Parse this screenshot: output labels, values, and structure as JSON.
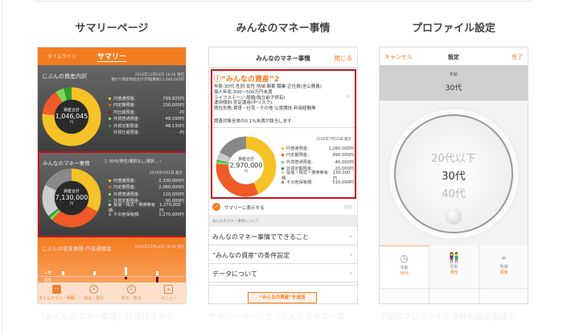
{
  "headings": [
    "サマリーページ",
    "みんなのマネー事情",
    "プロファイル設定"
  ],
  "captions": [
    "「みんなのマネー事情」は当行スマホ",
    "サマリーページで「みんなのマネー事",
    "下記はプロファイル条件の設定画面で"
  ],
  "colors": {
    "accent": "#f47c20",
    "highlight": "#c4141b",
    "yen_savings": "#f5c227",
    "yen_time": "#f05a28",
    "yen_other": "#8b1a1a",
    "fx_savings": "#7ed957",
    "fx_time": "#2e9e2e",
    "fx_other": "#1d5e1d",
    "stocks": "#cccccc",
    "other": "#888888"
  },
  "summary": {
    "tabs": [
      "タイムライン",
      "サマリー"
    ],
    "assets": {
      "title": "じぶんの資産内訳",
      "date": "2016年11月14日 18:16 現在",
      "sub": "預かり資産残高合計(円換算額):1,046,045円",
      "total_label": "資産合計",
      "total": "1,046,045",
      "unit": "円",
      "items": [
        {
          "label": "円普通預金:",
          "value": "799,825円",
          "amount": 799825,
          "color": "#f5c227"
        },
        {
          "label": "円定期預金:",
          "value": "150,000円",
          "amount": 150000,
          "color": "#f05a28"
        },
        {
          "label": "円仕組預金:",
          "value": "-円",
          "amount": 0,
          "color": "#8b1a1a"
        },
        {
          "label": "外貨普通預金:",
          "value": "48,090円",
          "amount": 48090,
          "color": "#7ed957"
        },
        {
          "label": "外貨定期預金:",
          "value": "48,130円",
          "amount": 48130,
          "color": "#2e9e2e"
        },
        {
          "label": "外貨仕組預金:",
          "value": "-円",
          "amount": 0,
          "color": "#1d5e1d"
        }
      ]
    },
    "money": {
      "title": "みんなのマネー事情",
      "filter": "30代/男性/選択なし/選択…",
      "date": "2016年6月1日 集計",
      "total_label": "資産合計",
      "total": "7,130,000",
      "unit": "円",
      "items": [
        {
          "label": "円普通預金:",
          "value": "2,330,000円",
          "amount": 2330000,
          "color": "#f5c227"
        },
        {
          "label": "円定期預金:",
          "value": "2,060,000円",
          "amount": 2060000,
          "color": "#f05a28"
        },
        {
          "label": "外貨普通預金:",
          "value": "110,000円",
          "amount": 110000,
          "color": "#7ed957"
        },
        {
          "label": "外貨定期預金:",
          "value": "90,000円",
          "amount": 90000,
          "color": "#2e9e2e"
        },
        {
          "label": "投信・株式・債券等有額:",
          "value": "1,270,000円",
          "amount": 1270000,
          "color": "#cccccc"
        },
        {
          "label": "その他保有額:",
          "value": "1,270,000円",
          "amount": 1270000,
          "color": "#888888"
        }
      ]
    },
    "flow": {
      "title": "じぶんの収支推移:円普通預金",
      "date": "2016年11月14日 18:16 現在",
      "in_label": "入金",
      "out_label": "出金"
    },
    "tabbar": [
      "タイムライン・明細",
      "振込・取引",
      "知る・学ぶ",
      "メニュー"
    ]
  },
  "money_page": {
    "title": "みんなのマネー事情",
    "close": "閉じる",
    "card": {
      "name": "“みんなの資産”2",
      "lines": [
        "年齢:30代 性別:女性 地域:関東 職業:正社員(含公務員)",
        "個人年収:300〜500万円未満",
        "ライフステージ:既婚(独立前子供有)",
        "運用傾向:安定運用(中リスク)",
        "居住形態:賃貸・社宅・その他 公営競技:利用経験無"
      ],
      "note": "調査対象全体の0.1%未満が該当します",
      "date": "2016年7月15日 集計",
      "total_label": "資産合計",
      "total": "2,970,000",
      "unit": "円",
      "items": [
        {
          "label": "円普通預金:",
          "value": "1,280,000円",
          "amount": 1280000,
          "color": "#f5c227"
        },
        {
          "label": "円定期預金:",
          "value": "990,000円",
          "amount": 990000,
          "color": "#f05a28"
        },
        {
          "label": "外貨普通預金:",
          "value": "40,000円",
          "amount": 40000,
          "color": "#7ed957"
        },
        {
          "label": "外貨定期預金:",
          "value": "20,000円",
          "amount": 20000,
          "color": "#2e9e2e"
        },
        {
          "label": "投信・株式・債券等有額:",
          "value": "130,000円",
          "amount": 130000,
          "color": "#cccccc"
        },
        {
          "label": "その他保有額:",
          "value": "510,000円",
          "amount": 510000,
          "color": "#888888"
        }
      ]
    },
    "show_in_summary": "サマリーに表示する",
    "delete": "削除",
    "section": "みんなのマネー事情について",
    "links": [
      "みんなのマネー事情でできること",
      "“みんなの資産”の条件設定",
      "データについて"
    ],
    "add_button": "“みんなの資産”を追加"
  },
  "profile": {
    "cancel": "キャンセル",
    "title": "設定",
    "done": "完了",
    "field_label": "年齢",
    "field_value": "30代",
    "wheel": [
      "20代以下",
      "30代",
      "40代"
    ],
    "grid": [
      {
        "label": "年齢",
        "value": "30代",
        "icon": "clock-icon"
      },
      {
        "label": "性別",
        "value": "男性",
        "icon": "people-icon"
      },
      {
        "label": "地域",
        "value": "関東",
        "icon": "map-pin-icon"
      }
    ]
  }
}
